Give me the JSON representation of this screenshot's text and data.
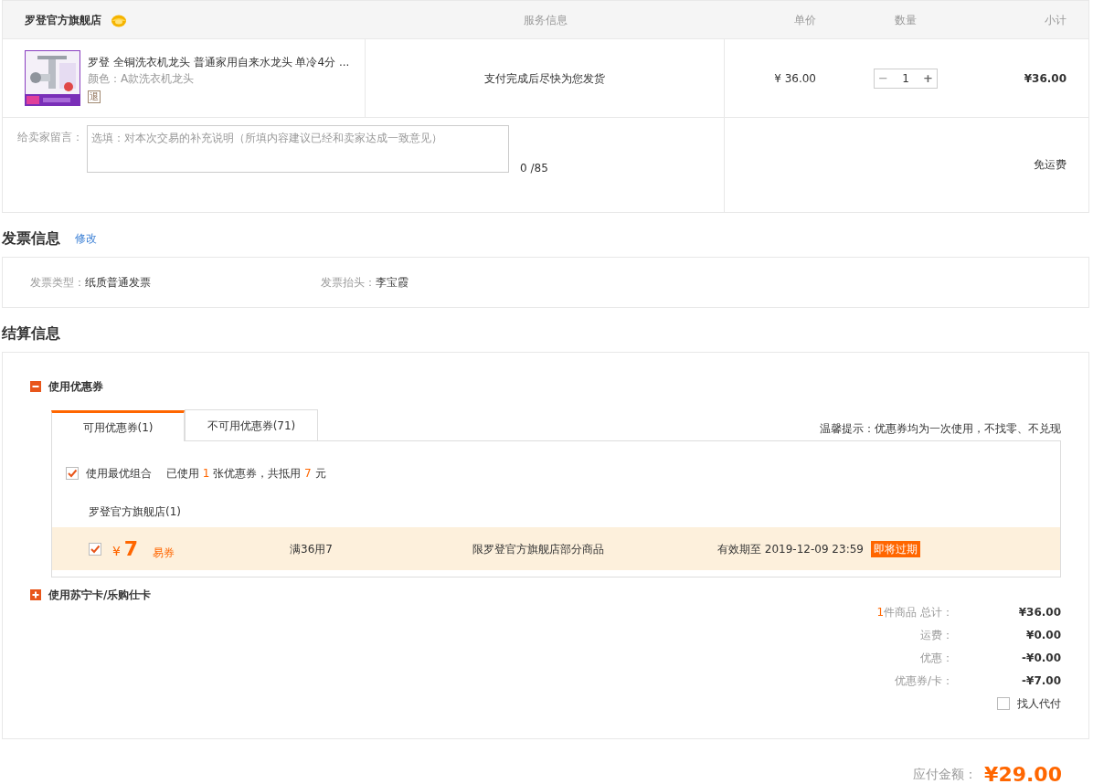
{
  "store": {
    "name": "罗登官方旗舰店"
  },
  "columns": [
    "服务信息",
    "单价",
    "数量",
    "小计"
  ],
  "item": {
    "title": "罗登 全铜洗衣机龙头 普通家用自来水龙头 单冷4分 ...",
    "variant": "颜色：A款洗衣机龙头",
    "return_badge": "退",
    "service": "支付完成后尽快为您发货",
    "unit_price": "¥ 36.00",
    "decrease": "−",
    "quantity": "1",
    "increase": "+",
    "subtotal": "¥36.00"
  },
  "message": {
    "label": "给卖家留言：",
    "placeholder": "选填：对本次交易的补充说明（所填内容建议已经和卖家达成一致意见）",
    "counter": "0 /85",
    "shipping": "免运费"
  },
  "invoice": {
    "heading": "发票信息",
    "edit_link": "修改",
    "fields": [
      {
        "label": "发票类型：",
        "value": "纸质普通发票"
      },
      {
        "label": "发票抬头：",
        "value": "李宝霞"
      }
    ]
  },
  "settlement": {
    "heading": "结算信息",
    "coupon_section": {
      "label": "使用优惠券",
      "expanded": true,
      "tabs": [
        {
          "label": "可用优惠券(1)",
          "selected": true
        },
        {
          "label": "不可用优惠券(71)",
          "selected": false
        }
      ],
      "tip": "温馨提示：优惠券均为一次使用，不找零、不兑现",
      "best_combo": {
        "checked": true,
        "label": "使用最优组合",
        "used_prefix": "已使用 ",
        "used_count": "1",
        "used_middle": " 张优惠券，共抵用 ",
        "used_amount": "7",
        "used_suffix": " 元"
      },
      "store_group": "罗登官方旗舰店(1)",
      "coupons": [
        {
          "checked": true,
          "currency": "¥",
          "amount": "7",
          "type": "易券",
          "condition": "满36用7",
          "scope": "限罗登官方旗舰店部分商品",
          "validity": "有效期至 2019-12-09 23:59",
          "expiring_badge": "即将过期"
        }
      ]
    },
    "card_section": {
      "label": "使用苏宁卡/乐购仕卡",
      "expanded": false
    },
    "summary": [
      {
        "count": "1",
        "label": "件商品 总计：",
        "value": "¥36.00"
      },
      {
        "label": "运费：",
        "value": "¥0.00"
      },
      {
        "label": "优惠：",
        "value": "-¥0.00"
      },
      {
        "label": "优惠券/卡：",
        "value": "-¥7.00"
      }
    ],
    "pay_for_me": {
      "label": "找人代付",
      "checked": false
    }
  },
  "total": {
    "label": "应付金额：",
    "value": "¥29.00"
  }
}
